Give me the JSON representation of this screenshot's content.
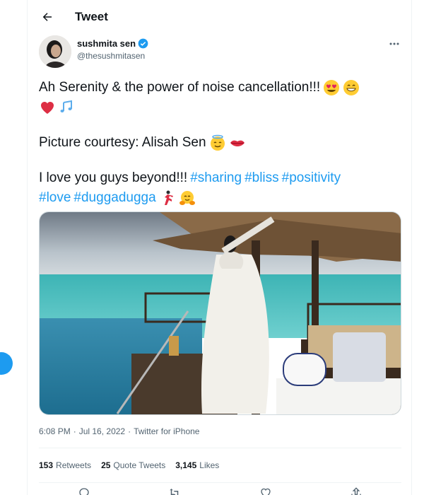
{
  "header": {
    "title": "Tweet",
    "back_icon": "back-arrow-icon"
  },
  "author": {
    "display_name": "sushmita sen",
    "handle": "@thesushmitasen",
    "verified": true,
    "more_icon": "more-dots-icon"
  },
  "tweet": {
    "line1": "Ah Serenity & the power of noise cancellation!!!",
    "line1_emojis": [
      "heart-eyes-emoji",
      "grinning-emoji"
    ],
    "line2_emojis": [
      "red-heart-emoji",
      "music-notes-emoji"
    ],
    "line3": "Picture courtesy: Alisah Sen",
    "line3_emojis": [
      "halo-face-emoji",
      "kiss-lips-emoji"
    ],
    "line4_text": "I love you guys beyond!!!",
    "hashtags_line4": [
      "#sharing",
      "#bliss",
      "#positivity"
    ],
    "hashtags_line5": [
      "#love",
      "#duggadugga"
    ],
    "line5_emojis": [
      "dancer-emoji",
      "hugging-face-emoji"
    ]
  },
  "meta": {
    "time": "6:08 PM",
    "separator": "·",
    "date": "Jul 16, 2022",
    "source": "Twitter for iPhone"
  },
  "stats": {
    "retweets_count": "153",
    "retweets_label": "Retweets",
    "quotes_count": "25",
    "quotes_label": "Quote Tweets",
    "likes_count": "3,145",
    "likes_label": "Likes"
  },
  "colors": {
    "link": "#1d9bf0",
    "secondary_text": "#536471",
    "verified": "#1d9bf0"
  }
}
